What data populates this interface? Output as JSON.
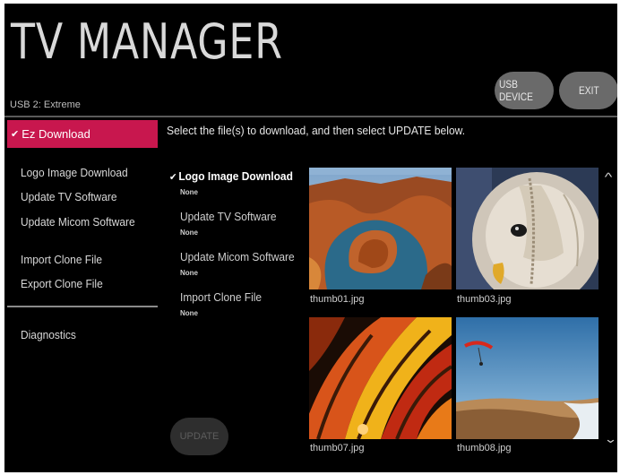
{
  "header": {
    "title": "TV MANAGER",
    "subtitle": "USB 2: Extreme",
    "usb_label": "USB DEVICE",
    "exit_label": "EXIT"
  },
  "sidebar": {
    "active": "Ez Download",
    "items": [
      "Logo Image Download",
      "Update TV Software",
      "Update Micom Software",
      "Import Clone File",
      "Export Clone File",
      "Diagnostics"
    ]
  },
  "main": {
    "instruction": "Select the file(s) to download, and then select UPDATE below.",
    "options": [
      {
        "label": "Logo Image Download",
        "value": "None"
      },
      {
        "label": "Update TV Software",
        "value": "None"
      },
      {
        "label": "Update Micom Software",
        "value": "None"
      },
      {
        "label": "Import Clone File",
        "value": "None"
      }
    ],
    "update_label": "UPDATE"
  },
  "thumbs": [
    {
      "name": "thumb01.jpg",
      "icon": "canyon-image"
    },
    {
      "name": "thumb03.jpg",
      "icon": "owl-image"
    },
    {
      "name": "thumb07.jpg",
      "icon": "balloon-image"
    },
    {
      "name": "thumb08.jpg",
      "icon": "paraglider-image"
    }
  ],
  "colors": {
    "accent": "#c8174e",
    "background": "#000000"
  }
}
